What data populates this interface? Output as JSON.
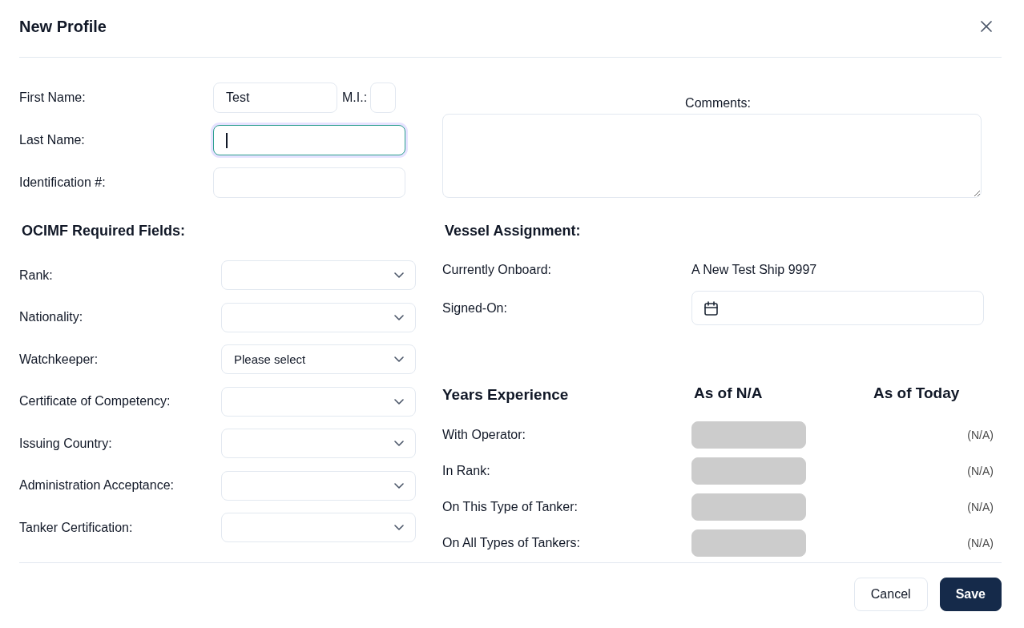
{
  "dialog": {
    "title": "New Profile"
  },
  "personal": {
    "fields": [
      {
        "label": "First Name:",
        "value": "Test",
        "focused": false,
        "middle_initial": {
          "label": "M.I.:",
          "focused": false
        }
      },
      {
        "label": "Last Name:",
        "focused": true
      },
      {
        "label": "Identification #:",
        "focused": false
      }
    ]
  },
  "comments": {
    "label": "Comments:"
  },
  "ocimf": {
    "title": "OCIMF Required Fields:",
    "fields": [
      {
        "label": "Rank:"
      },
      {
        "label": "Nationality:"
      },
      {
        "label": "Watchkeeper:",
        "value": "Please select"
      },
      {
        "label": "Certificate of Competency:"
      },
      {
        "label": "Issuing Country:"
      },
      {
        "label": "Administration Acceptance:"
      },
      {
        "label": "Tanker Certification:"
      }
    ]
  },
  "vessel": {
    "title": "Vessel Assignment:",
    "currently_onboard": {
      "label": "Currently Onboard:",
      "value": "A New Test Ship 9997"
    },
    "signed_on": {
      "label": "Signed-On:"
    }
  },
  "experience": {
    "title": "Years Experience",
    "columns": [
      "As of N/A",
      "As of Today"
    ],
    "rows": [
      {
        "label": "With Operator:",
        "disabled": true,
        "today": "(N/A)"
      },
      {
        "label": "In Rank:",
        "disabled": true,
        "today": "(N/A)"
      },
      {
        "label": "On This Type of Tanker:",
        "disabled": true,
        "today": "(N/A)"
      },
      {
        "label": "On All Types of Tankers:",
        "disabled": true,
        "today": "(N/A)"
      }
    ]
  },
  "buttons": [
    {
      "label": "Cancel",
      "kind": "secondary"
    },
    {
      "label": "Save",
      "kind": "primary"
    }
  ]
}
